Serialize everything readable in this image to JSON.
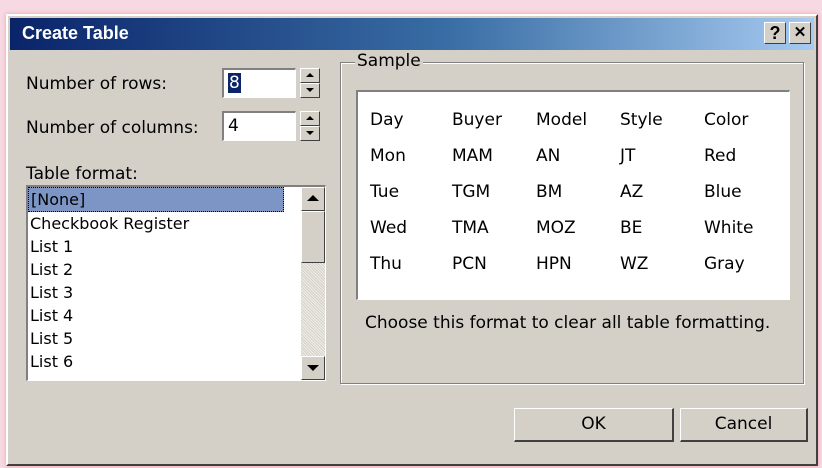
{
  "dialog": {
    "title": "Create Table",
    "help_label": "?",
    "close_label": "✕"
  },
  "rows": {
    "label": "Number of rows:",
    "value": "8"
  },
  "columns": {
    "label": "Number of columns:",
    "value": "4"
  },
  "table_format": {
    "label": "Table format:",
    "selected": "[None]",
    "items": [
      "[None]",
      "Checkbook Register",
      "List 1",
      "List 2",
      "List 3",
      "List 4",
      "List 5",
      "List 6"
    ]
  },
  "sample": {
    "legend": "Sample",
    "rows": [
      [
        "Day",
        "Buyer",
        "Model",
        "Style",
        "Color"
      ],
      [
        "Mon",
        "MAM",
        "AN",
        "JT",
        "Red"
      ],
      [
        "Tue",
        "TGM",
        "BM",
        "AZ",
        "Blue"
      ],
      [
        "Wed",
        "TMA",
        "MOZ",
        "BE",
        "White"
      ],
      [
        "Thu",
        "PCN",
        "HPN",
        "WZ",
        "Gray"
      ]
    ],
    "description": "Choose this format to clear all table formatting."
  },
  "buttons": {
    "ok": "OK",
    "cancel": "Cancel"
  },
  "colors": {
    "title_gradient_start": "#0a246a",
    "title_gradient_end": "#a6caf0",
    "dialog_face": "#d4d0c8",
    "selection": "#7d95c5"
  }
}
